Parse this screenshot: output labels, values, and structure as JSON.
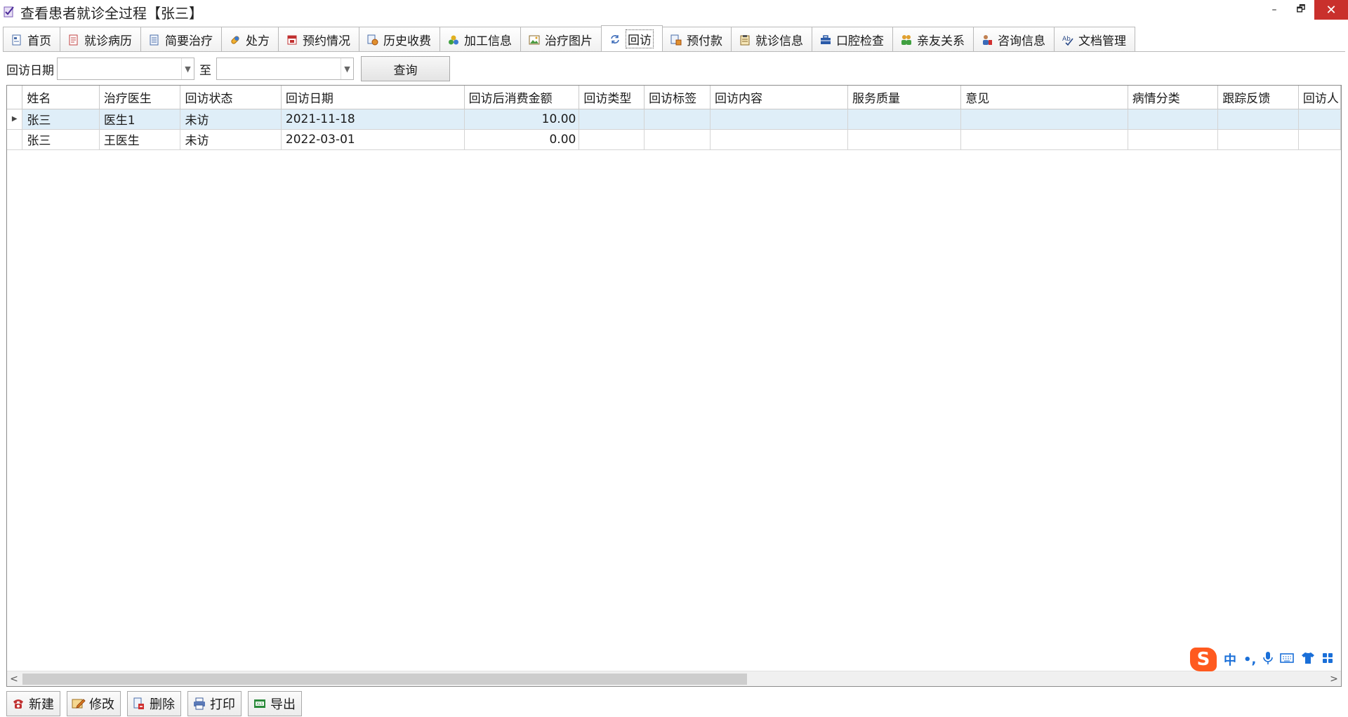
{
  "window": {
    "title": "查看患者就诊全过程【张三】",
    "controls": {
      "minimize": "–",
      "restore": "🗗",
      "close": "✕"
    }
  },
  "tabs": [
    {
      "label": "首页",
      "icon": "home-doc-icon",
      "active": false
    },
    {
      "label": "就诊病历",
      "icon": "medical-record-icon",
      "active": false
    },
    {
      "label": "简要治疗",
      "icon": "document-icon",
      "active": false
    },
    {
      "label": "处方",
      "icon": "pill-icon",
      "active": false
    },
    {
      "label": "预约情况",
      "icon": "calendar-icon",
      "active": false
    },
    {
      "label": "历史收费",
      "icon": "billing-history-icon",
      "active": false
    },
    {
      "label": "加工信息",
      "icon": "processing-icon",
      "active": false
    },
    {
      "label": "治疗图片",
      "icon": "image-icon",
      "active": false
    },
    {
      "label": "回访",
      "icon": "refresh-icon",
      "active": true
    },
    {
      "label": "预付款",
      "icon": "prepayment-icon",
      "active": false
    },
    {
      "label": "就诊信息",
      "icon": "clipboard-icon",
      "active": false
    },
    {
      "label": "口腔检查",
      "icon": "briefcase-icon",
      "active": false
    },
    {
      "label": "亲友关系",
      "icon": "people-icon",
      "active": false
    },
    {
      "label": "咨询信息",
      "icon": "consult-user-icon",
      "active": false
    },
    {
      "label": "文档管理",
      "icon": "spellcheck-icon",
      "active": false
    }
  ],
  "filter": {
    "date_label": "回访日期",
    "start_value": "",
    "to_label": "至",
    "end_value": "",
    "query_button": "查询"
  },
  "grid": {
    "columns": [
      "姓名",
      "治疗医生",
      "回访状态",
      "回访日期",
      "回访后消费金额",
      "回访类型",
      "回访标签",
      "回访内容",
      "服务质量",
      "意见",
      "病情分类",
      "跟踪反馈",
      "回访人"
    ],
    "rows": [
      {
        "selected": true,
        "cells": [
          "张三",
          "医生1",
          "未访",
          "2021-11-18",
          "10.00",
          "",
          "",
          "",
          "",
          "",
          "",
          "",
          ""
        ]
      },
      {
        "selected": false,
        "cells": [
          "张三",
          "王医生",
          "未访",
          "2022-03-01",
          "0.00",
          "",
          "",
          "",
          "",
          "",
          "",
          "",
          ""
        ]
      }
    ]
  },
  "scrollbar": {
    "left_arrow": "<",
    "right_arrow": ">"
  },
  "ime": {
    "logo": "S",
    "mode": "中",
    "punct": "•,",
    "mic": "🎤",
    "keyboard": "⌨",
    "skin": "👕",
    "apps": "▦"
  },
  "toolbar": {
    "buttons": [
      {
        "label": "新建",
        "icon": "phone-icon"
      },
      {
        "label": "修改",
        "icon": "edit-icon"
      },
      {
        "label": "删除",
        "icon": "delete-icon"
      },
      {
        "label": "打印",
        "icon": "printer-icon"
      },
      {
        "label": "导出",
        "icon": "export-icon"
      }
    ]
  },
  "colors": {
    "accent": "#1a6fd8",
    "selected_row": "#dfeef8",
    "close": "#c9302c"
  }
}
